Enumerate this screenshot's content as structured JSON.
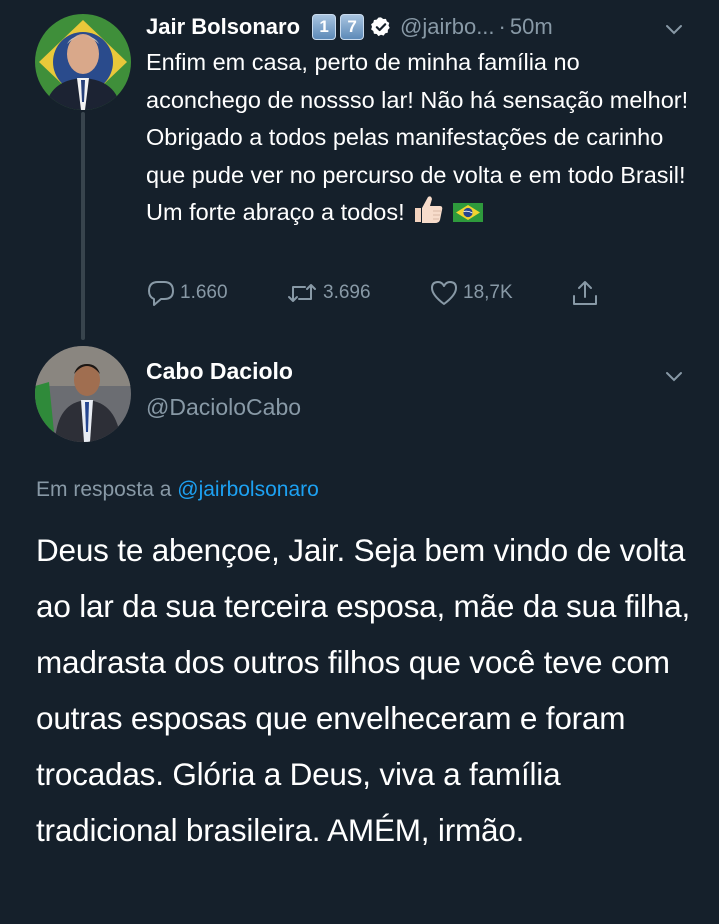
{
  "tweet1": {
    "author_name": "Jair Bolsonaro",
    "badges": [
      "1",
      "7"
    ],
    "handle": "@jairbo...",
    "separator": "·",
    "time": "50m",
    "text": "Enfim em casa, perto de minha família no aconchego de nossso lar! Não há sensação melhor! Obrigado a todos pelas manifestações de carinho que pude ver no percurso de volta e em todo Brasil! Um forte abraço a todos!",
    "emojis": [
      "thumbs-up",
      "brazil-flag"
    ],
    "stats": {
      "replies": "1.660",
      "retweets": "3.696",
      "likes": "18,7K"
    }
  },
  "tweet2": {
    "author_name": "Cabo Daciolo",
    "handle": "@DacioloCabo",
    "reply_prefix": "Em resposta a",
    "reply_mention": "@jairbolsonaro",
    "text": "Deus te abençoe, Jair. Seja bem vindo de volta ao lar da sua terceira esposa, mãe da sua filha, madrasta dos outros filhos que você teve com outras esposas que envelheceram e foram trocadas. Glória a Deus, viva a família tradicional brasileira. AMÉM, irmão."
  },
  "colors": {
    "background": "#15202b",
    "secondary_text": "#8899a6",
    "link": "#1da1f2",
    "thread_line": "#38444d"
  }
}
